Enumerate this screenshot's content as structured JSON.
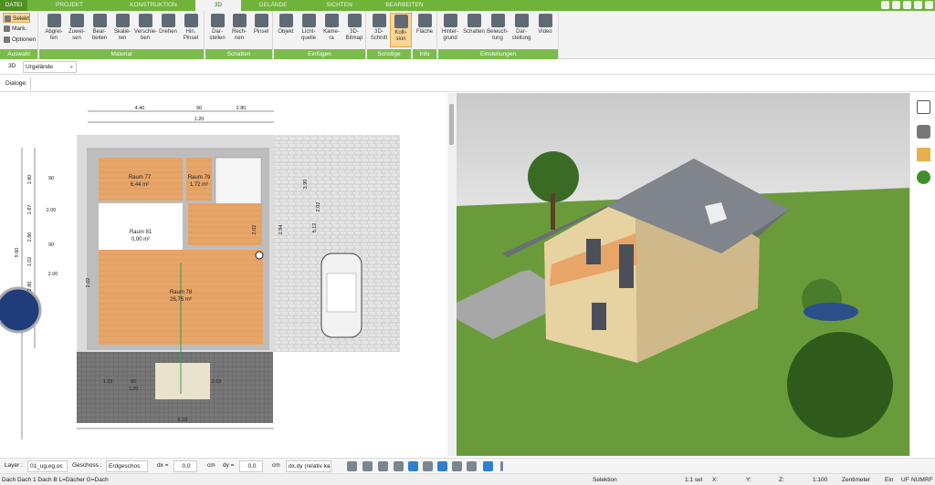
{
  "tabs": [
    {
      "label": "DATEI",
      "w": 30
    },
    {
      "label": "PROJEKT",
      "w": 92
    },
    {
      "label": "KONSTRUKTION",
      "w": 92
    },
    {
      "label": "3D",
      "w": 50
    },
    {
      "label": "GELÄNDE",
      "w": 70
    },
    {
      "label": "SICHTEN",
      "w": 75
    },
    {
      "label": "BEARBEITEN",
      "w": 68
    }
  ],
  "ribbon": {
    "auswahl": {
      "label": "Auswahl",
      "items": [
        "Selekt",
        "Mark.",
        "Optionen"
      ]
    },
    "material": {
      "label": "Material",
      "buttons": [
        "Abgrei-\nfen",
        "Zuwei-\nsen",
        "Bear-\nbeiten",
        "Skalie-\nren",
        "Verschie-\nben",
        "Drehen",
        "Hin.\nPinsel"
      ]
    },
    "schatten": {
      "label": "Schatten",
      "buttons": [
        "Dar-\nstellen",
        "Rech-\nnen",
        "Pinsel"
      ]
    },
    "einfuegen": {
      "label": "Einfügen",
      "buttons": [
        "Objekt",
        "Licht-\nquelle",
        "Kame-\nra",
        "3D-\nBitmap"
      ]
    },
    "sonstige": {
      "label": "Sonstige",
      "buttons": [
        "3D-\nSchnitt",
        "Kolli-\nsion"
      ]
    },
    "info": {
      "label": "Info",
      "buttons": [
        "Fläche"
      ]
    },
    "einstellungen": {
      "label": "Einstellungen",
      "buttons": [
        "Hinter-\ngrund",
        "Schatten",
        "Beleuch-\ntung",
        "Dar-\nstellung",
        "Video"
      ]
    }
  },
  "toolbar3d": {
    "label": "3D",
    "select": "Urgelände"
  },
  "dialoge": {
    "label": "Dialoge:"
  },
  "plan": {
    "rooms": [
      {
        "name": "Raum 77",
        "area": "6,44 m²"
      },
      {
        "name": "Raum 79",
        "area": "1,72 m²"
      },
      {
        "name": "Raum 81",
        "area": "0,00 m²"
      },
      {
        "name": "Raum 78",
        "area": "26,75 m²"
      }
    ],
    "dims_top": [
      "4.40",
      "90",
      "2.80",
      "1.20"
    ],
    "dims_left": [
      "1.80",
      "1.87",
      "2.80",
      "1.02",
      "2.80",
      "9.60"
    ],
    "dims_inner": [
      "90",
      "2.00",
      "90",
      "2.00",
      "2.02",
      "2.02",
      "2.94",
      "3.90",
      "2.02",
      "5.12"
    ],
    "dims_bottom": [
      "1.53",
      "90",
      "1.20",
      "2.63",
      "5.10"
    ]
  },
  "status": {
    "layer_label": "Layer :",
    "layer_value": "01_ug,eg,oc",
    "geschoss_label": "Geschoss :",
    "geschoss_value": "Erdgeschos",
    "dx_label": "dx =",
    "dx_value": "0,0",
    "dx_unit": "cm",
    "dy_label": "dy =",
    "dy_value": "0,0",
    "dy_unit": "cm",
    "relative": "dx,dy (relativ ka"
  },
  "status2": {
    "object": "Dach Dach 1 Dach B L=Dächer G=Dach",
    "mode": "Selektion",
    "sel": "1:1 sel",
    "x": "X:",
    "y": "Y:",
    "z": "Z:",
    "scale": "1:100",
    "unit": "Zentimeter",
    "ein": "Ein",
    "uf": "UF",
    "num": "NUM",
    "rf": "RF"
  },
  "colors": {
    "tab_green": "#6fb33b",
    "group_green": "#7cbc4b",
    "floor": "#e7a568",
    "active": "#f8d694"
  }
}
